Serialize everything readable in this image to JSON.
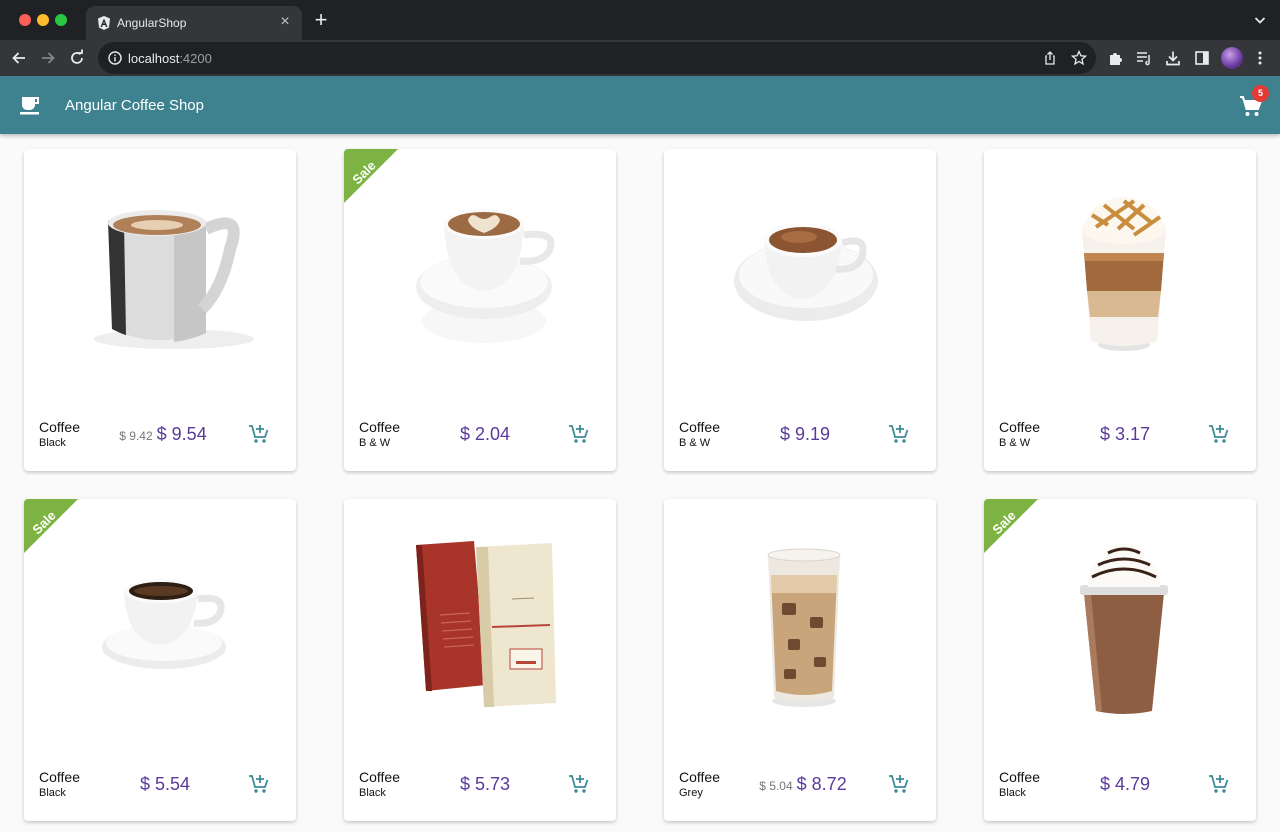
{
  "browser": {
    "tab_title": "AngularShop",
    "url_host": "localhost",
    "url_port": ":4200"
  },
  "app": {
    "title": "Angular Coffee Shop",
    "cart_count": "5",
    "colors": {
      "header": "#3d828e",
      "price": "#5a3a9a",
      "sale_ribbon": "#7cb342",
      "badge": "#e53935"
    }
  },
  "products": [
    {
      "name": "Coffee",
      "variant": "Black",
      "old_price": "$ 9.42",
      "price": "$ 9.54",
      "sale": false,
      "image": "mug-latte-image"
    },
    {
      "name": "Coffee",
      "variant": "B & W",
      "old_price": "",
      "price": "$ 2.04",
      "sale": true,
      "sale_label": "Sale",
      "image": "cappuccino-cup-image"
    },
    {
      "name": "Coffee",
      "variant": "B & W",
      "old_price": "",
      "price": "$ 9.19",
      "sale": false,
      "image": "espresso-cup-image"
    },
    {
      "name": "Coffee",
      "variant": "B & W",
      "old_price": "",
      "price": "$ 3.17",
      "sale": false,
      "image": "latte-macchiato-glass-image"
    },
    {
      "name": "Coffee",
      "variant": "Black",
      "old_price": "",
      "price": "$ 5.54",
      "sale": true,
      "sale_label": "Sale",
      "image": "black-coffee-cup-image"
    },
    {
      "name": "Coffee",
      "variant": "Black",
      "old_price": "",
      "price": "$ 5.73",
      "sale": false,
      "image": "coffee-bags-image"
    },
    {
      "name": "Coffee",
      "variant": "Grey",
      "old_price": "$ 5.04",
      "price": "$ 8.72",
      "sale": false,
      "image": "iced-coffee-glass-image"
    },
    {
      "name": "Coffee",
      "variant": "Black",
      "old_price": "",
      "price": "$ 4.79",
      "sale": true,
      "sale_label": "Sale",
      "image": "frappe-cup-image"
    }
  ]
}
